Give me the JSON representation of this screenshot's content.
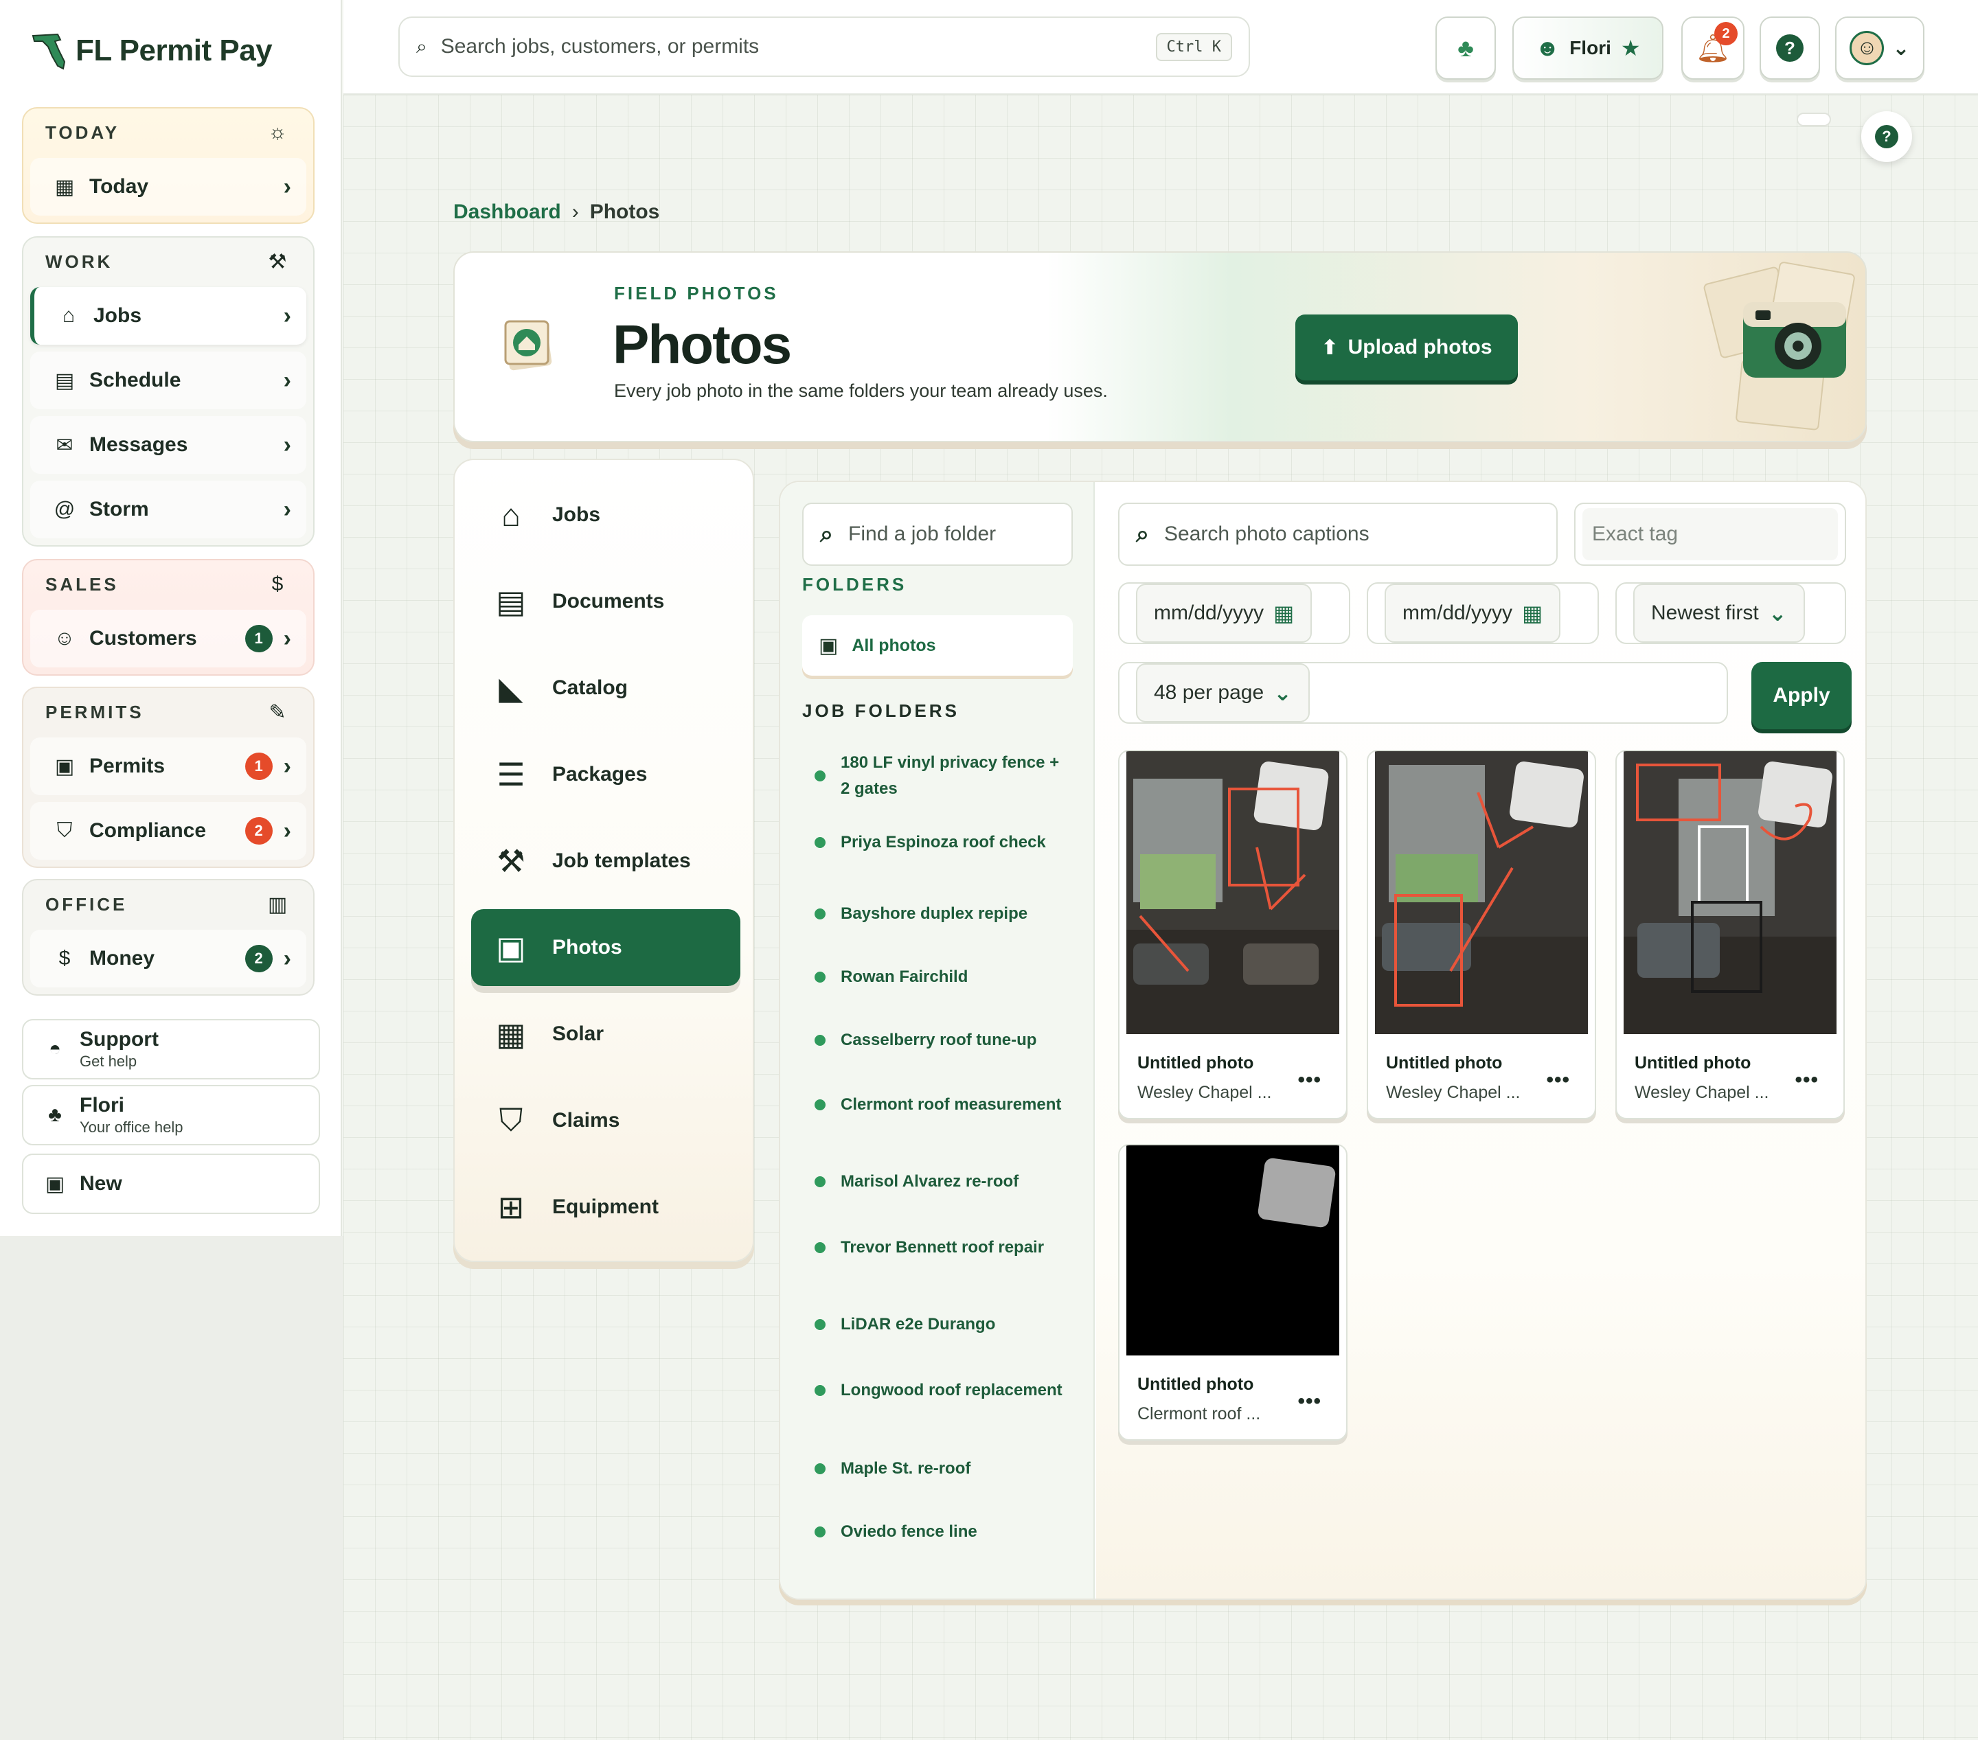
{
  "app": {
    "name": "FL Permit Pay"
  },
  "topbar": {
    "search_placeholder": "Search jobs, customers, or permits",
    "shortcut": "Ctrl K",
    "assistant_name": "Flori",
    "notifications_count": "2"
  },
  "sidebar": {
    "groups": {
      "today": {
        "title": "TODAY",
        "items": [
          {
            "label": "Today"
          }
        ]
      },
      "work": {
        "title": "WORK",
        "items": [
          {
            "label": "Jobs"
          },
          {
            "label": "Schedule"
          },
          {
            "label": "Messages"
          },
          {
            "label": "Storm"
          }
        ]
      },
      "sales": {
        "title": "SALES",
        "items": [
          {
            "label": "Customers",
            "badge": "1"
          }
        ]
      },
      "permits": {
        "title": "PERMITS",
        "items": [
          {
            "label": "Permits",
            "badge": "1"
          },
          {
            "label": "Compliance",
            "badge": "2"
          }
        ]
      },
      "office": {
        "title": "OFFICE",
        "items": [
          {
            "label": "Money",
            "badge": "2"
          }
        ]
      }
    },
    "support": {
      "title": "Support",
      "subtitle": "Get help"
    },
    "flori": {
      "title": "Flori",
      "subtitle": "Your office help"
    },
    "new": {
      "title": "New"
    }
  },
  "breadcrumb": {
    "root": "Dashboard",
    "sep": "›",
    "current": "Photos"
  },
  "hero": {
    "eyebrow": "FIELD PHOTOS",
    "title": "Photos",
    "subtitle": "Every job photo in the same folders your team already uses.",
    "upload_label": "Upload photos"
  },
  "menu": [
    {
      "label": "Jobs"
    },
    {
      "label": "Documents"
    },
    {
      "label": "Catalog"
    },
    {
      "label": "Packages"
    },
    {
      "label": "Job templates"
    },
    {
      "label": "Photos"
    },
    {
      "label": "Solar"
    },
    {
      "label": "Claims"
    },
    {
      "label": "Equipment"
    }
  ],
  "folders": {
    "search_placeholder": "Find a job folder",
    "heading": "FOLDERS",
    "all_label": "All photos",
    "job_heading": "JOB FOLDERS",
    "items": [
      "180 LF vinyl privacy fence + 2 gates",
      "Priya Espinoza roof check",
      "Bayshore duplex repipe",
      "Rowan Fairchild",
      "Casselberry roof tune-up",
      "Clermont roof measurement",
      "Marisol Alvarez re-roof",
      "Trevor Bennett roof repair",
      "LiDAR e2e Durango",
      "Longwood roof replacement",
      "Maple St. re-roof",
      "Oviedo fence line"
    ]
  },
  "filters": {
    "caption_placeholder": "Search photo captions",
    "tag_placeholder": "Exact tag",
    "date_from": "mm/dd/yyyy",
    "date_to": "mm/dd/yyyy",
    "sort": "Newest first",
    "per_page": "48 per page",
    "apply_label": "Apply"
  },
  "photos": [
    {
      "title": "Untitled photo",
      "location": "Wesley Chapel ..."
    },
    {
      "title": "Untitled photo",
      "location": "Wesley Chapel ..."
    },
    {
      "title": "Untitled photo",
      "location": "Wesley Chapel ..."
    },
    {
      "title": "Untitled photo",
      "location": "Clermont roof ..."
    }
  ],
  "colors": {
    "brand": "#1d6a43",
    "alert": "#e54b2a",
    "annotation": "#e8553a"
  }
}
